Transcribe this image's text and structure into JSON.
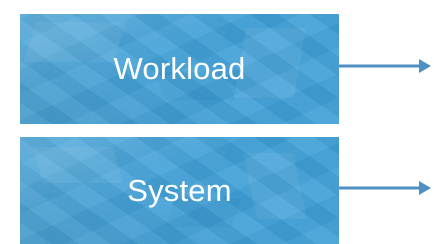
{
  "diagram": {
    "boxes": [
      {
        "id": "workload",
        "label": "Workload",
        "has_outgoing_arrow": true
      },
      {
        "id": "system",
        "label": "System",
        "has_outgoing_arrow": true
      }
    ],
    "colors": {
      "box_fill": "#3f9fd6",
      "box_text": "#ffffff",
      "arrow": "#4f8fc2"
    }
  }
}
